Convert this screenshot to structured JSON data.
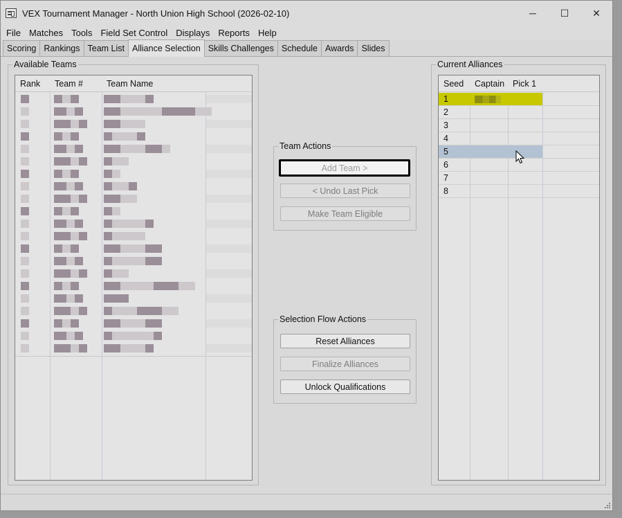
{
  "window": {
    "title": "VEX Tournament Manager - North Union High School (2026-02-10)",
    "minimize_glyph": "─",
    "maximize_glyph": "☐",
    "close_glyph": "✕"
  },
  "menu": [
    "File",
    "Matches",
    "Tools",
    "Field Set Control",
    "Displays",
    "Reports",
    "Help"
  ],
  "tabs": [
    "Scoring",
    "Rankings",
    "Team List",
    "Alliance Selection",
    "Skills Challenges",
    "Schedule",
    "Awards",
    "Slides"
  ],
  "active_tab": "Alliance Selection",
  "available_teams": {
    "title": "Available Teams",
    "columns": [
      "Rank",
      "Team #",
      "Team Name"
    ]
  },
  "team_actions": {
    "title": "Team Actions",
    "add_team": "Add Team >",
    "undo_last_pick": "< Undo Last Pick",
    "make_team_eligible": "Make Team Eligible"
  },
  "selection_flow": {
    "title": "Selection Flow Actions",
    "reset_alliances": "Reset Alliances",
    "finalize_alliances": "Finalize Alliances",
    "unlock_qualifications": "Unlock Qualifications"
  },
  "current_alliances": {
    "title": "Current Alliances",
    "columns": [
      "Seed",
      "Captain",
      "Pick 1"
    ],
    "rows": [
      {
        "seed": "1",
        "state": "current"
      },
      {
        "seed": "2",
        "state": "normal"
      },
      {
        "seed": "3",
        "state": "normal"
      },
      {
        "seed": "4",
        "state": "normal"
      },
      {
        "seed": "5",
        "state": "hover"
      },
      {
        "seed": "6",
        "state": "normal"
      },
      {
        "seed": "7",
        "state": "normal"
      },
      {
        "seed": "8",
        "state": "normal"
      }
    ]
  },
  "colors": {
    "current_row": "#c8c800",
    "hover_row": "#b2c2d2",
    "pixel_dark": "#9a8e98",
    "pixel_light": "#cdc8cb"
  }
}
